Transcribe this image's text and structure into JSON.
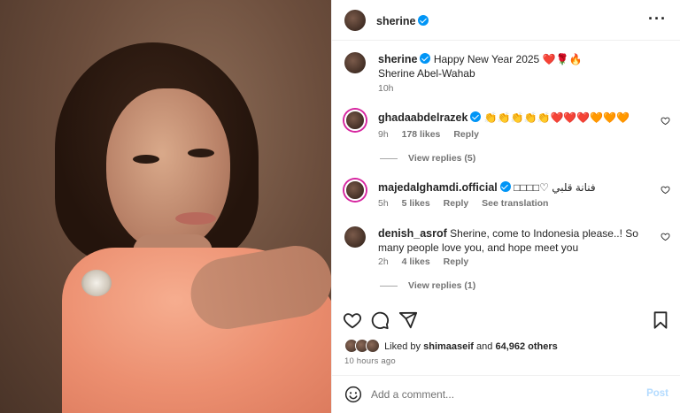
{
  "post": {
    "author": "sherine",
    "menu_icon": "more-horizontal-icon",
    "caption": {
      "username": "sherine",
      "text_line1": "Happy New Year 2025 ❤️🌹🔥",
      "text_line2": "Sherine Abel-Wahab",
      "time": "10h"
    },
    "comments": [
      {
        "username": "ghadaabdelrazek",
        "verified": true,
        "text": "👏👏👏👏👏❤️❤️❤️🧡🧡🧡",
        "time": "9h",
        "likes": "178 likes",
        "reply": "Reply",
        "view_replies": "View replies (5)"
      },
      {
        "username": "majedalghamdi.official",
        "verified": true,
        "text": "□□□□♡ فنانة قلبي",
        "time": "5h",
        "likes": "5 likes",
        "reply": "Reply",
        "see_translation": "See translation"
      },
      {
        "username": "denish_asrof",
        "verified": false,
        "text": "Sherine, come to Indonesia please..! So many people love you, and hope meet you",
        "time": "2h",
        "likes": "4 likes",
        "reply": "Reply",
        "view_replies": "View replies (1)"
      }
    ],
    "liked_by_prefix": "Liked by",
    "liked_by_user": "shimaaseif",
    "liked_by_and": "and",
    "liked_by_others": "64,962 others",
    "timestamp": "10 hours ago",
    "add_comment_placeholder": "Add a comment...",
    "post_button": "Post"
  },
  "colors": {
    "verified": "#0095f6",
    "muted": "#737373",
    "post_disabled": "#b3dbff",
    "story_ring": "#d6249f"
  }
}
